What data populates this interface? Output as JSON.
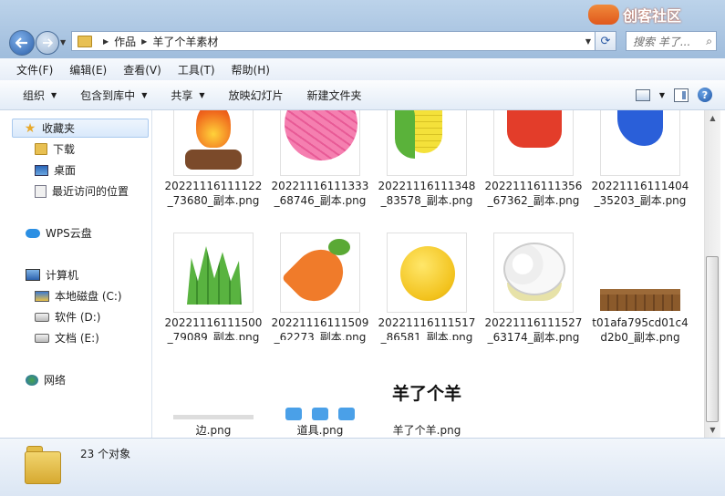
{
  "titlebar": {
    "watermark": "创客社区",
    "breadcrumb": [
      "作品",
      "羊了个羊素材"
    ],
    "search_placeholder": "搜索 羊了..."
  },
  "menu": [
    "文件(F)",
    "编辑(E)",
    "查看(V)",
    "工具(T)",
    "帮助(H)"
  ],
  "toolbar": {
    "organize": "组织",
    "include_library": "包含到库中",
    "share": "共享",
    "slideshow": "放映幻灯片",
    "new_folder": "新建文件夹"
  },
  "nav": {
    "favorites": "收藏夹",
    "downloads": "下载",
    "desktop": "桌面",
    "recent": "最近访问的位置",
    "wps": "WPS云盘",
    "computer": "计算机",
    "drive_c": "本地磁盘 (C:)",
    "drive_d": "软件 (D:)",
    "drive_e": "文档 (E:)",
    "network": "网络"
  },
  "files": [
    {
      "name": "20221116111122_73680_副本.png",
      "icon": "campfire"
    },
    {
      "name": "20221116111333_68746_副本.png",
      "icon": "yarn-ball"
    },
    {
      "name": "20221116111348_83578_副本.png",
      "icon": "corn"
    },
    {
      "name": "20221116111356_67362_副本.png",
      "icon": "bucket"
    },
    {
      "name": "20221116111404_35203_副本.png",
      "icon": "glove"
    },
    {
      "name": "20221116111500_79089_副本.png",
      "icon": "grass"
    },
    {
      "name": "20221116111509_62273_副本.png",
      "icon": "carrot"
    },
    {
      "name": "20221116111517_86581_副本.png",
      "icon": "bell"
    },
    {
      "name": "20221116111527_63174_副本.png",
      "icon": "cauliflower"
    },
    {
      "name": "t01afa795cd01c4d2b0_副本.png",
      "icon": "fence"
    },
    {
      "name": "边.png",
      "icon": "edge"
    },
    {
      "name": "道具.png",
      "icon": "tools"
    },
    {
      "name": "羊了个羊.png",
      "icon": "title-text",
      "image_text": "羊了个羊"
    }
  ],
  "status": {
    "count": "23 个对象"
  }
}
